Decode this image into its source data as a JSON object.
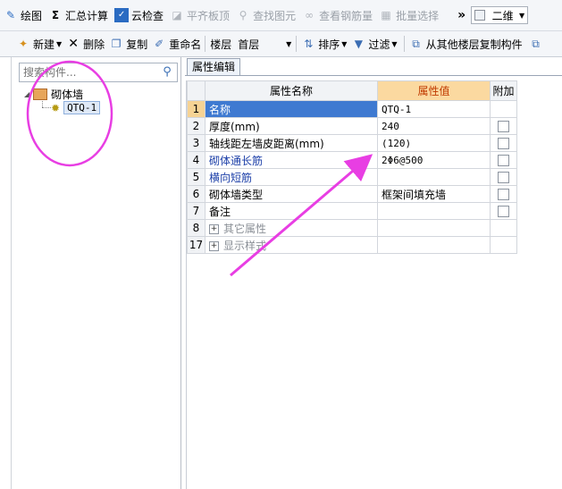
{
  "toolbar1": {
    "items": [
      {
        "icon": "draw-icon",
        "label": "绘图"
      },
      {
        "icon": "sigma-icon",
        "label": "汇总计算"
      },
      {
        "icon": "cloud-check-icon",
        "label": "云检查"
      },
      {
        "icon": "level-slab-icon",
        "label": "平齐板顶",
        "disabled": true
      },
      {
        "icon": "find-icon",
        "label": "查找图元",
        "disabled": true
      },
      {
        "icon": "view-rebar-icon",
        "label": "查看钢筋量",
        "disabled": true
      },
      {
        "icon": "batch-select-icon",
        "label": "批量选择",
        "disabled": true
      }
    ],
    "overflow": "»",
    "view_mode": "二维"
  },
  "toolbar2": {
    "new_label": "新建",
    "delete_label": "删除",
    "copy_label": "复制",
    "rename_label": "重命名",
    "floor_label": "楼层",
    "floor_value": "首层",
    "sort_label": "排序",
    "filter_label": "过滤",
    "copy_from_floor_label": "从其他楼层复制构件"
  },
  "left_panel": {
    "search_placeholder": "搜索构件...",
    "tree": {
      "root_label": "砌体墙",
      "child_label": "QTQ-1"
    }
  },
  "right_panel": {
    "tab_label": "属性编辑",
    "columns": {
      "name": "属性名称",
      "value": "属性值",
      "extra": "附加"
    },
    "rows": [
      {
        "num": "1",
        "name": "名称",
        "value": "QTQ-1",
        "name_style": "selected",
        "checkbox": false
      },
      {
        "num": "2",
        "name": "厚度(mm)",
        "value": "240",
        "name_style": "normal",
        "checkbox": true
      },
      {
        "num": "3",
        "name": "轴线距左墙皮距离(mm)",
        "value": "(120)",
        "name_style": "normal",
        "checkbox": true
      },
      {
        "num": "4",
        "name": "砌体通长筋",
        "value": "2Φ6@500",
        "name_style": "blue",
        "checkbox": true
      },
      {
        "num": "5",
        "name": "横向短筋",
        "value": "",
        "name_style": "blue",
        "checkbox": true
      },
      {
        "num": "6",
        "name": "砌体墙类型",
        "value": "框架间填充墙",
        "name_style": "normal",
        "checkbox": true
      },
      {
        "num": "7",
        "name": "备注",
        "value": "",
        "name_style": "normal",
        "checkbox": true
      },
      {
        "num": "8",
        "name": "其它属性",
        "value": "",
        "name_style": "group",
        "checkbox": false
      },
      {
        "num": "17",
        "name": "显示样式",
        "value": "",
        "name_style": "group",
        "checkbox": false
      }
    ]
  },
  "colors": {
    "annotation": "#e83ee3",
    "selection": "#3f7ad1",
    "value_header": "#fbd9a0"
  }
}
